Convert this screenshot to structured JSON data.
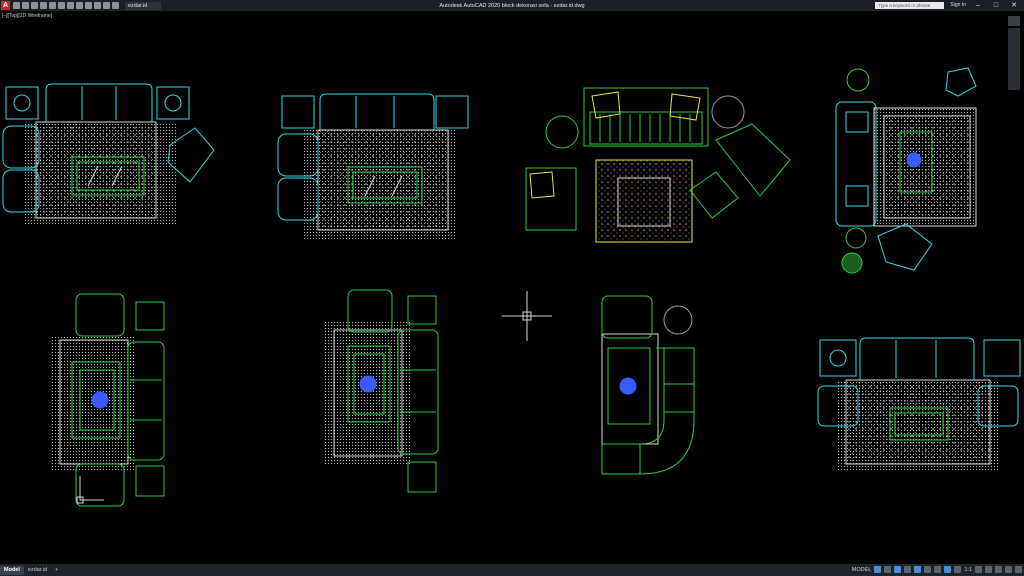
{
  "titlebar": {
    "app_logo": "A",
    "file_tab": "ezdar.id",
    "window_title": "Autodesk AutoCAD 2020    block dekorasi sofa - ezdar.id.dwg",
    "search_placeholder": "Type a keyword or phrase",
    "sign_in": "Sign In",
    "minimize": "–",
    "maximize": "□",
    "close": "✕"
  },
  "viewport": {
    "label": "[–][Top][2D Wireframe]"
  },
  "bottombar": {
    "tabs": [
      "Model",
      "ezdar.id"
    ],
    "add_tab": "+",
    "model_label": "MODEL",
    "scale": "1:1"
  },
  "colors": {
    "cyan": "#33d6e8",
    "green": "#2ecc40",
    "yellow": "#e8e84a",
    "white": "#d8d8d8",
    "blue": "#3a5bff",
    "grey": "#9a9a9a"
  }
}
